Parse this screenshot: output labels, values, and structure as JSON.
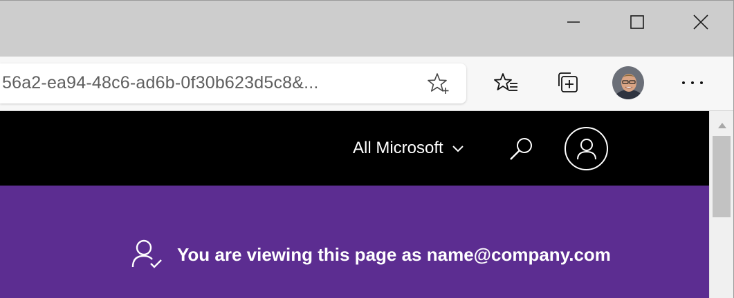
{
  "window_controls": {
    "minimize": "minimize",
    "maximize": "maximize",
    "close": "close"
  },
  "address_bar": {
    "url_visible": "56a2-ea94-48c6-ad6b-0f30b623d5c8&..."
  },
  "toolbar": {
    "icons": [
      "add-favorite-icon",
      "favorites-icon",
      "collections-icon",
      "profile-avatar",
      "more-icon"
    ]
  },
  "header": {
    "all_microsoft_label": "All Microsoft"
  },
  "banner": {
    "text": "You are viewing this page as name@company.com"
  },
  "colors": {
    "header_bg": "#000000",
    "banner_bg": "#5c2d91",
    "chrome_bg": "#cdcdcd",
    "toolbar_bg": "#f7f7f7"
  }
}
